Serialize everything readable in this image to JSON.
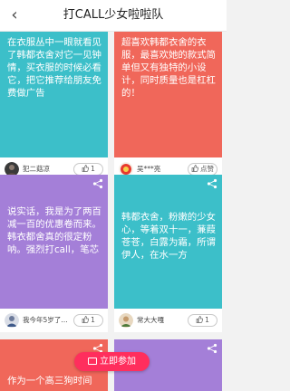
{
  "header": {
    "back_icon": "‹",
    "title": "打CALL少女啦啦队"
  },
  "colors": {
    "teal": "#3cbfc9",
    "coral": "#f0675a",
    "purple": "#a47fd8",
    "accent": "#ff2e5d"
  },
  "cards": [
    {
      "text": "在衣服丛中一眼就看见了韩都衣舍对它一见钟情，买衣服的时候必看它，把它推荐给朋友免费做广告",
      "user": "犯二菇凉",
      "like_label": "1"
    },
    {
      "text": "超喜欢韩都衣舍的衣服，最喜欢她的款式简单但又有独特的小设计，同时质量也是杠杠的！",
      "user": "吴***亮",
      "like_label": "点赞"
    },
    {
      "text": "说实话，我是为了两百减一百的优惠卷而来。韩衣都舍真的很定粉呐。强烈打call，笔芯",
      "user": "我今年5岁了…",
      "like_label": "1"
    },
    {
      "text": "韩都衣舍，粉嫩的少女心，等着双十一，蒹葭苍苍，白露为霜，所谓伊人，在水一方",
      "user": "常大大嘎",
      "like_label": "1"
    },
    {
      "text": "作为一个高三狗时间"
    },
    {
      "text": ""
    }
  ],
  "join_button": {
    "label": "立即参加"
  }
}
